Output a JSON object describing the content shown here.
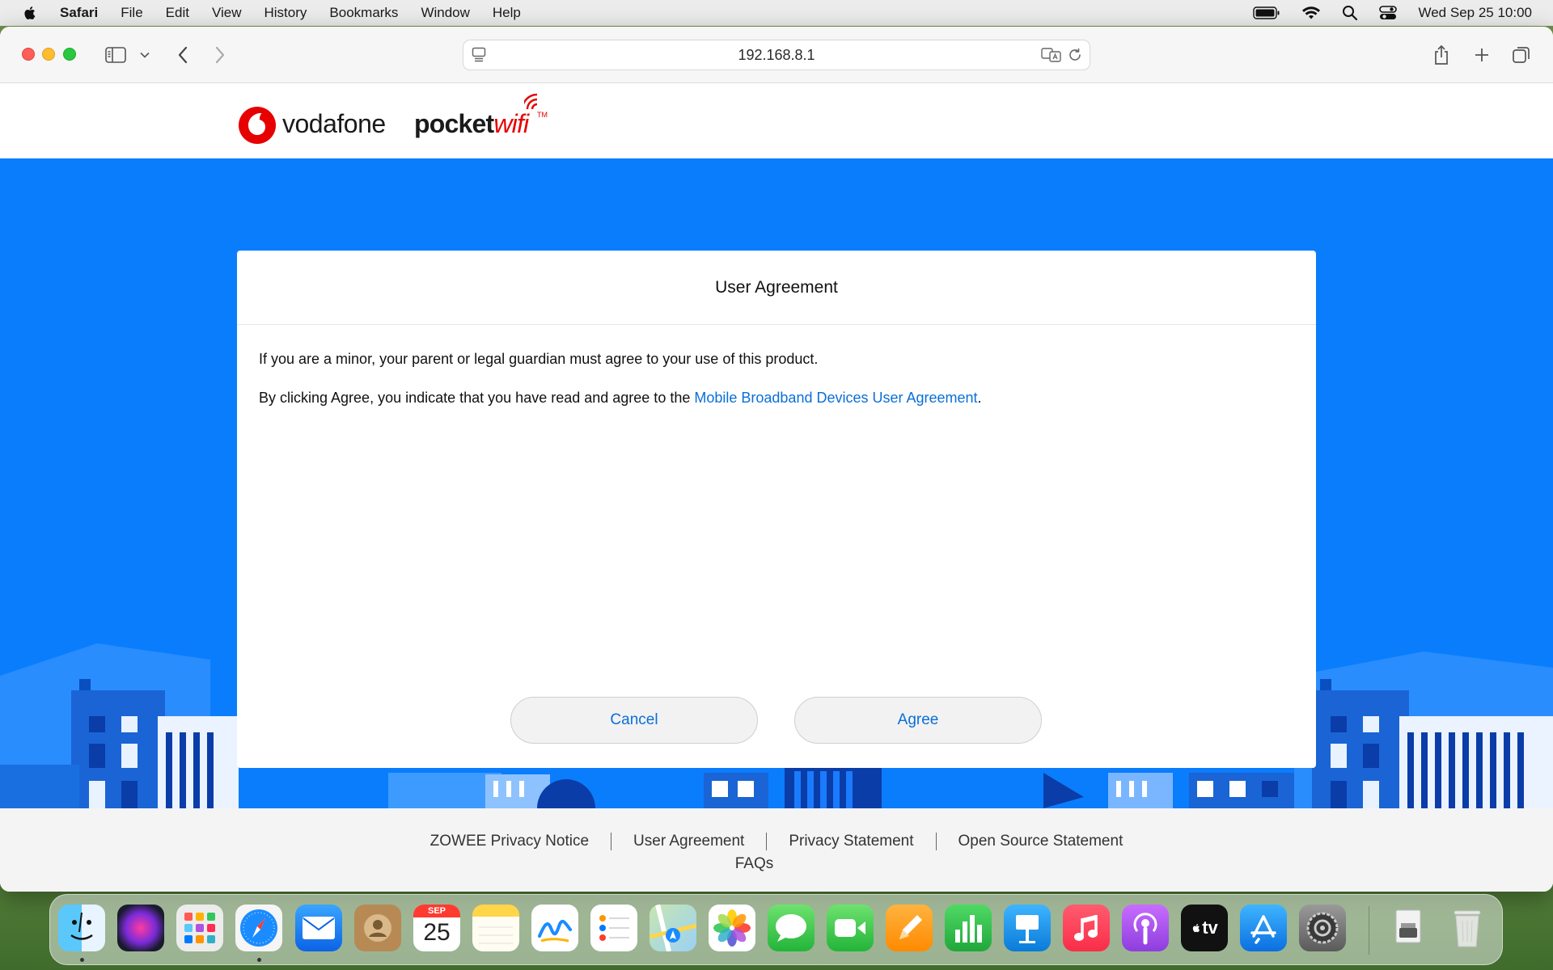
{
  "menubar": {
    "app_name": "Safari",
    "items": [
      "File",
      "Edit",
      "View",
      "History",
      "Bookmarks",
      "Window",
      "Help"
    ],
    "clock": "Wed Sep 25  10:00"
  },
  "browser": {
    "url": "192.168.8.1"
  },
  "brand": {
    "vodafone": "vodafone",
    "pocket": "pocket",
    "wifi": "wifi",
    "tm": "TM"
  },
  "dialog": {
    "title": "User Agreement",
    "paragraph1": "If you are a minor, your parent or legal guardian must agree to your use of this product.",
    "paragraph2_prefix": "By clicking Agree, you indicate that you have read and agree to the ",
    "paragraph2_link": "Mobile Broadband Devices User Agreement",
    "paragraph2_suffix": ".",
    "cancel_label": "Cancel",
    "agree_label": "Agree"
  },
  "footer": {
    "links": [
      "ZOWEE Privacy Notice",
      "User Agreement",
      "Privacy Statement",
      "Open Source Statement"
    ],
    "faqs": "FAQs"
  },
  "dock": {
    "calendar_month": "SEP",
    "calendar_day": "25",
    "tv_label": "tv",
    "apps": [
      "Finder",
      "Siri",
      "Launchpad",
      "Safari",
      "Mail",
      "Contacts",
      "Calendar",
      "Notes",
      "Freeform",
      "Reminders",
      "Maps",
      "Photos",
      "Messages",
      "FaceTime",
      "Pages",
      "Numbers",
      "Keynote",
      "Music",
      "Podcasts",
      "TV",
      "App Store",
      "System Settings",
      "Downloads",
      "Trash"
    ]
  },
  "colors": {
    "brand_blue": "#0a7dfc",
    "link_blue": "#0a6fd8",
    "vodafone_red": "#e60000"
  }
}
